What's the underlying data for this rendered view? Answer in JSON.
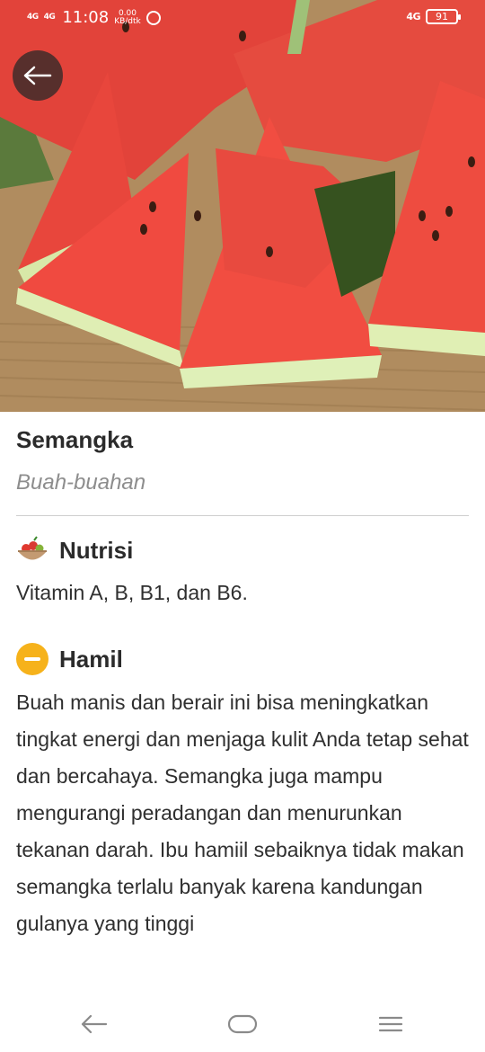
{
  "status": {
    "signal1": "4G",
    "signal2": "4G",
    "time": "11:08",
    "speed_value": "0.00",
    "speed_unit": "KB/dtk",
    "network_right": "4G",
    "battery": "91"
  },
  "item": {
    "title": "Semangka",
    "category": "Buah-buahan"
  },
  "nutrisi": {
    "title": "Nutrisi",
    "text": "Vitamin A, B, B1, dan B6."
  },
  "hamil": {
    "title": "Hamil",
    "text": "Buah manis dan berair ini bisa meningkatkan tingkat energi dan menjaga kulit Anda tetap sehat dan bercahaya. Semangka juga mampu mengurangi peradangan dan menurunkan tekanan darah. Ibu hamiil sebaiknya tidak makan semangka terlalu banyak karena kandungan gulanya yang tinggi"
  },
  "icons": {
    "back": "arrow-left-icon",
    "nutrisi": "fruit-bowl-icon",
    "hamil": "minus-circle-icon",
    "nav_back": "back-arrow-icon",
    "nav_home": "home-icon",
    "nav_menu": "menu-icon"
  },
  "colors": {
    "hamil_badge": "#f6b21b",
    "divider": "#cfcfcf",
    "category_text": "#8d8d8d"
  }
}
